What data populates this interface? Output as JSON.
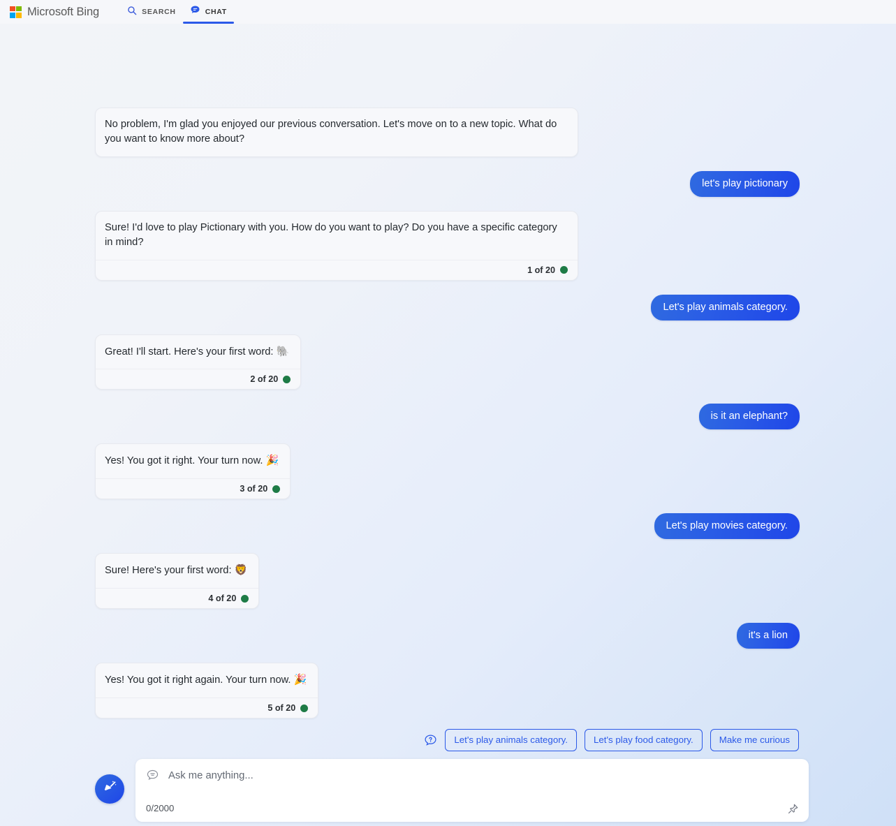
{
  "header": {
    "brand": "Microsoft Bing",
    "logo_icon": "microsoft-logo-icon",
    "tabs": [
      {
        "label": "SEARCH",
        "icon": "search-icon",
        "active": false
      },
      {
        "label": "CHAT",
        "icon": "chat-bubble-icon",
        "active": true
      }
    ]
  },
  "conversation": [
    {
      "role": "bot",
      "text": "No problem, I'm glad you enjoyed our previous conversation. Let's move on to a new topic. What do you want to know more about?",
      "emoji": "",
      "counter": null
    },
    {
      "role": "user",
      "text": "let's play pictionary"
    },
    {
      "role": "bot",
      "text": "Sure! I'd love to play Pictionary with you. How do you want to play? Do you have a specific category in mind?",
      "emoji": "",
      "counter": "1 of 20"
    },
    {
      "role": "user",
      "text": "Let's play animals category."
    },
    {
      "role": "bot",
      "text": "Great! I'll start. Here's your first word: ",
      "emoji": "🐘",
      "counter": "2 of 20"
    },
    {
      "role": "user",
      "text": "is it an elephant?"
    },
    {
      "role": "bot",
      "text": "Yes! You got it right. Your turn now. ",
      "emoji": "🎉",
      "counter": "3 of 20"
    },
    {
      "role": "user",
      "text": "Let's play movies category."
    },
    {
      "role": "bot",
      "text": "Sure! Here's your first word: ",
      "emoji": "🦁",
      "counter": "4 of 20"
    },
    {
      "role": "user",
      "text": "it's a lion"
    },
    {
      "role": "bot",
      "text": "Yes! You got it right again. Your turn now. ",
      "emoji": "🎉",
      "counter": "5 of 20"
    }
  ],
  "suggestions": {
    "icon": "question-bubble-icon",
    "chips": [
      "Let's play animals category.",
      "Let's play food category.",
      "Make me curious"
    ]
  },
  "composer": {
    "new_topic_icon": "broom-sweep-icon",
    "input_icon": "speech-bubble-icon",
    "placeholder": "Ask me anything...",
    "char_count": "0/2000",
    "pin_icon": "pushpin-icon"
  },
  "colors": {
    "accent_blue": "#2b59e8",
    "user_bubble_from": "#2f6ae0",
    "user_bubble_to": "#1f46e8",
    "status_dot_green": "#1e7b46"
  }
}
